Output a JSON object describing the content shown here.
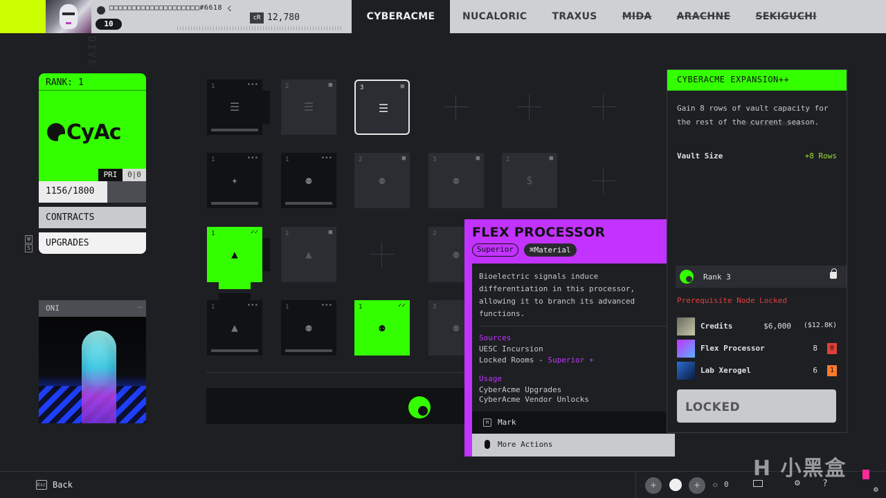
{
  "header": {
    "player_name": "□□□□□□□□□□□□□□□□□□□□#6618",
    "level": "10",
    "currency_code": "cR",
    "currency_amount": "12,780",
    "tabs": [
      {
        "label": "CYBERACME",
        "active": true,
        "struck": false
      },
      {
        "label": "NUCALORIC",
        "active": false,
        "struck": false
      },
      {
        "label": "TRAXUS",
        "active": false,
        "struck": false
      },
      {
        "label": "MIDA",
        "active": false,
        "struck": true
      },
      {
        "label": "ARACHNE",
        "active": false,
        "struck": true
      },
      {
        "label": "SEKIGUCHI",
        "active": false,
        "struck": true
      }
    ]
  },
  "sidebar": {
    "vertical_text": "DIVE / / NE    D / S",
    "rank_label": "RANK: 1",
    "faction_logo_text": "CyAc",
    "pri_label": "PRI",
    "pri_score": "0|0",
    "reputation_text": "1156/1800",
    "reputation_progress": 0.64,
    "contracts_label": "CONTRACTS",
    "upgrades_label": "UPGRADES",
    "key_up": "W",
    "key_down": "S",
    "contact_name": "ONI",
    "contact_menu": "—"
  },
  "grid": {
    "nodes": [
      {
        "num": "1",
        "corner": "•••",
        "glyph": "☰",
        "state": "dark"
      },
      {
        "num": "2",
        "corner": "■",
        "glyph": "☰",
        "state": "dim"
      },
      {
        "num": "3",
        "corner": "■",
        "glyph": "☰",
        "state": "selected"
      },
      {
        "num": "1",
        "corner": "•••",
        "glyph": "✦",
        "state": "dark"
      },
      {
        "num": "1",
        "corner": "•••",
        "glyph": "⚉",
        "state": "dark"
      },
      {
        "num": "2",
        "corner": "■",
        "glyph": "⚉",
        "state": "dim"
      },
      {
        "num": "3",
        "corner": "■",
        "glyph": "⚉",
        "state": "dim"
      },
      {
        "num": "2",
        "corner": "■",
        "glyph": "$",
        "state": "dim"
      },
      {
        "num": "1",
        "corner": "✓✓",
        "glyph": "▲",
        "state": "lit"
      },
      {
        "num": "2",
        "corner": "■",
        "glyph": "▲",
        "state": "dim"
      },
      {
        "num": "2",
        "corner": "■",
        "glyph": "⚉",
        "state": "dim"
      },
      {
        "num": "1",
        "corner": "•••",
        "glyph": "▲",
        "state": "dark"
      },
      {
        "num": "1",
        "corner": "•••",
        "glyph": "⚉",
        "state": "dark"
      },
      {
        "num": "1",
        "corner": "✓✓",
        "glyph": "⚉",
        "state": "lit"
      },
      {
        "num": "3",
        "corner": "",
        "glyph": "⚉",
        "state": "dim"
      }
    ]
  },
  "tooltip": {
    "title": "FLEX PROCESSOR",
    "rarity": "Superior",
    "type": "Material",
    "type_icon": "⌘",
    "description": "Bioelectric signals induce differentiation in this processor, allowing it to branch its advanced functions.",
    "sources_label": "Sources",
    "source_1": "UESC Incursion",
    "source_2_prefix": "Locked Rooms - ",
    "source_2_hl": "Superior +",
    "usage_label": "Usage",
    "usage_1": "CyberAcme Upgrades",
    "usage_2": "CyberAcme Vendor Unlocks",
    "mark_key": "M",
    "mark_label": "Mark",
    "more_label": "More Actions"
  },
  "detail": {
    "title": "CYBERACME EXPANSION++",
    "description": "Gain 8 rows of vault capacity for the rest of the current season.",
    "ghost_text": "F17098826C0D0DE",
    "stat_label": "Vault Size",
    "stat_value": "+8 Rows",
    "rank_label": "Rank 3",
    "prereq_text": "Prerequisite Node Locked",
    "requirements": [
      {
        "name": "Credits",
        "amount": "$6,000",
        "extra": "($12.8K)",
        "have": ""
      },
      {
        "name": "Flex Processor",
        "amount": "8",
        "extra": "",
        "have": "0"
      },
      {
        "name": "Lab Xerogel",
        "amount": "6",
        "extra": "",
        "have": "1"
      }
    ],
    "locked_label": "LOCKED"
  },
  "footer": {
    "esc_key": "Esc",
    "back_label": "Back",
    "squad_count": "0",
    "watermark": "H 小黑盒"
  },
  "colors": {
    "accent_green": "#33ff00",
    "lime": "#ccff00",
    "purple": "#c233ff",
    "danger": "#e0403a"
  }
}
